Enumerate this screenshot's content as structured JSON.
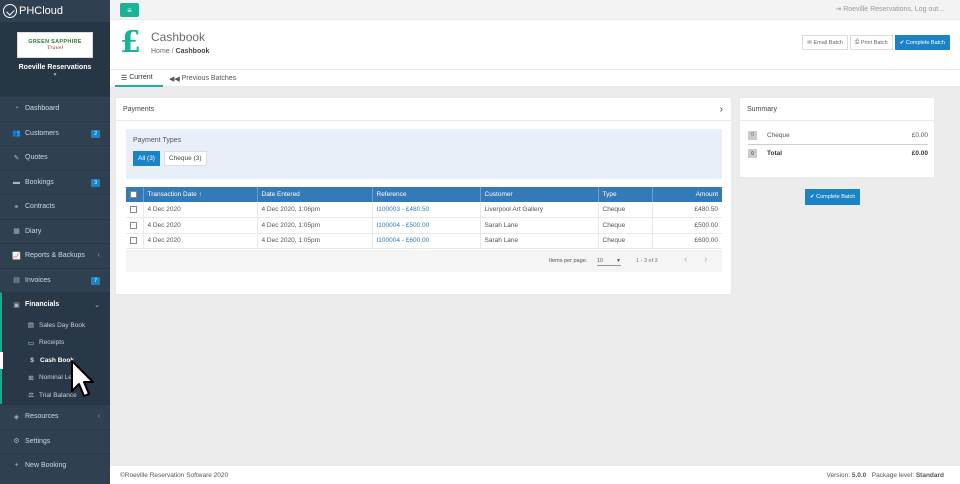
{
  "app": {
    "logo": "PHCloud"
  },
  "sidebar": {
    "brand_line1": "GREEN SAPPHIRE",
    "brand_line2": "Travel",
    "profile_name": "Roeville Reservations",
    "items": [
      {
        "label": "Dashboard",
        "icon": "tachometer-icon"
      },
      {
        "label": "Customers",
        "icon": "users-icon",
        "badge": "2"
      },
      {
        "label": "Quotes",
        "icon": "pencil-icon"
      },
      {
        "label": "Bookings",
        "icon": "book-icon",
        "badge": "3"
      },
      {
        "label": "Contracts",
        "icon": "handshake-icon"
      },
      {
        "label": "Diary",
        "icon": "calendar-icon"
      },
      {
        "label": "Reports & Backups",
        "icon": "chart-icon"
      },
      {
        "label": "Invoices",
        "icon": "file-icon",
        "badge": "7"
      },
      {
        "label": "Financials",
        "icon": "money-icon"
      },
      {
        "label": "Resources",
        "icon": "cube-icon"
      },
      {
        "label": "Settings",
        "icon": "cogs-icon"
      },
      {
        "label": "New Booking",
        "icon": "plus-icon"
      }
    ],
    "sub_items": [
      {
        "label": "Sales Day Book",
        "icon": "list-icon"
      },
      {
        "label": "Receipts",
        "icon": "receipt-icon"
      },
      {
        "label": "Cash Book",
        "icon": "dollar-icon"
      },
      {
        "label": "Nominal Ledger",
        "icon": "sitemap-icon"
      },
      {
        "label": "Trial Balance",
        "icon": "balance-icon"
      }
    ]
  },
  "topbar": {
    "logout": "Roeville Reservations, Log out..."
  },
  "header": {
    "title": "Cashbook",
    "breadcrumb_home": "Home",
    "breadcrumb_sep": "/",
    "breadcrumb_current": "Cashbook",
    "buttons": {
      "email": "Email Batch",
      "print": "Print Batch",
      "complete": "Complete Batch"
    }
  },
  "tabs": {
    "current": "Current",
    "previous": "Previous Batches"
  },
  "payments": {
    "heading": "Payments",
    "types_label": "Payment Types",
    "type_all": "All (3)",
    "type_cheque": "Cheque (3)",
    "columns": [
      "Transaction Date",
      "Date Entered",
      "Reference",
      "Customer",
      "Type",
      "Amount"
    ],
    "rows": [
      {
        "date": "4 Dec 2020",
        "entered": "4 Dec 2020, 1:06pm",
        "ref": "I100003 - £480.50",
        "customer": "Liverpool Art Gallery",
        "type": "Cheque",
        "amount": "£480.50"
      },
      {
        "date": "4 Dec 2020",
        "entered": "4 Dec 2020, 1:05pm",
        "ref": "I100004 - £500.00",
        "customer": "Sarah Lane",
        "type": "Cheque",
        "amount": "£500.00"
      },
      {
        "date": "4 Dec 2020",
        "entered": "4 Dec 2020, 1:05pm",
        "ref": "I100004 - £600.00",
        "customer": "Sarah Lane",
        "type": "Cheque",
        "amount": "£600.00"
      }
    ],
    "items_per_page_label": "Items per page:",
    "items_per_page": "10",
    "range": "1 - 3 of 3"
  },
  "summary": {
    "heading": "Summary",
    "rows": [
      {
        "count": "0",
        "label": "Cheque",
        "value": "£0.00"
      },
      {
        "count": "0",
        "label": "Total",
        "value": "£0.00"
      }
    ],
    "complete_button": "Complete Batch"
  },
  "footer": {
    "copyright": "©Roeville Reservation Software 2020",
    "version_label": "Version:",
    "version": "5.0.0",
    "package_label": "Package level:",
    "package": "Standard"
  }
}
